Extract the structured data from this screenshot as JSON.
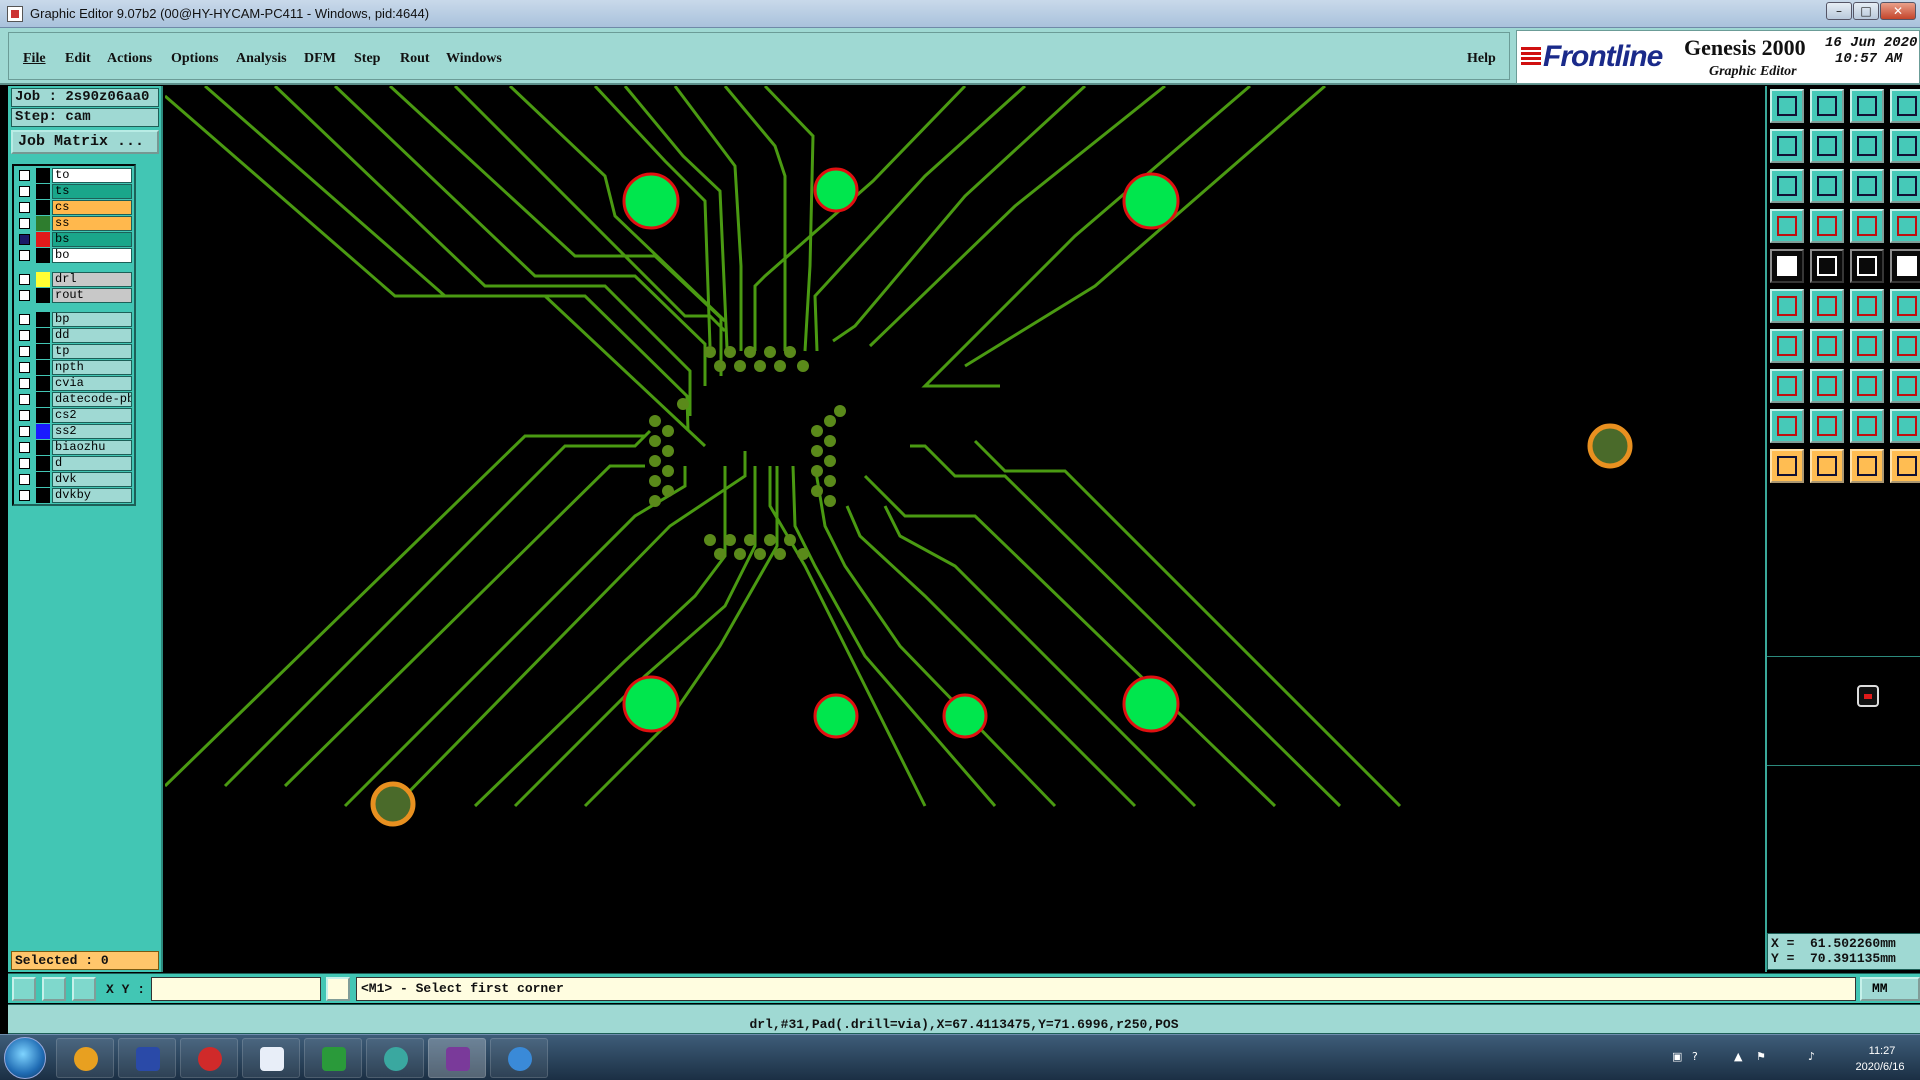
{
  "window": {
    "title": "Graphic Editor 9.07b2 (00@HY-HYCAM-PC411 - Windows, pid:4644)",
    "minimize": "–",
    "maximize": "□",
    "close": "✕"
  },
  "menu": {
    "items": [
      "File",
      "Edit",
      "Actions",
      "Options",
      "Analysis",
      "DFM",
      "Step",
      "Rout",
      "Windows"
    ],
    "help": "Help"
  },
  "brand": {
    "logo": "Frontline",
    "product": "Genesis 2000",
    "subtitle": "Graphic Editor",
    "date": "16 Jun 2020",
    "time": "10:57 AM"
  },
  "job": {
    "job_line": "Job : 2s90z06aa0",
    "step_line": "Step: cam",
    "matrix_button": "Job Matrix ..."
  },
  "layers": [
    {
      "name": "to",
      "swatch": "#000000",
      "bg": "#ffffff",
      "mark": "⸙",
      "checked": false
    },
    {
      "name": "ts",
      "swatch": "#000000",
      "bg": "#1aa68a",
      "mark": "",
      "checked": false
    },
    {
      "name": "cs",
      "swatch": "#000000",
      "bg": "#ffb84d",
      "mark": "⸙",
      "checked": false
    },
    {
      "name": "ss",
      "swatch": "#2e7d2e",
      "bg": "#ffb84d",
      "mark": "",
      "checked": false
    },
    {
      "name": "bs",
      "swatch": "#e01a1a",
      "bg": "#1aa68a",
      "mark": "▪",
      "checked": true
    },
    {
      "name": "bo",
      "swatch": "#000000",
      "bg": "#ffffff",
      "mark": "",
      "checked": false
    },
    {
      "name": "drl",
      "swatch": "#ffff33",
      "bg": "#c8c8c8",
      "mark": "",
      "checked": false
    },
    {
      "name": "rout",
      "swatch": "#000000",
      "bg": "#c8c8c8",
      "mark": "",
      "checked": false
    },
    {
      "name": "bp",
      "swatch": "#000000",
      "bg": "#9fd9d3",
      "mark": "",
      "checked": false
    },
    {
      "name": "dd",
      "swatch": "#000000",
      "bg": "#9fd9d3",
      "mark": "⸙",
      "checked": false
    },
    {
      "name": "tp",
      "swatch": "#000000",
      "bg": "#9fd9d3",
      "mark": "",
      "checked": false
    },
    {
      "name": "npth",
      "swatch": "#000000",
      "bg": "#9fd9d3",
      "mark": "",
      "checked": false
    },
    {
      "name": "cvia",
      "swatch": "#000000",
      "bg": "#9fd9d3",
      "mark": "",
      "checked": false
    },
    {
      "name": "datecode-pb",
      "swatch": "#000000",
      "bg": "#9fd9d3",
      "mark": "",
      "checked": false
    },
    {
      "name": "cs2",
      "swatch": "#000000",
      "bg": "#9fd9d3",
      "mark": "",
      "checked": false
    },
    {
      "name": "ss2",
      "swatch": "#1a1aff",
      "bg": "#9fd9d3",
      "mark": "",
      "checked": false
    },
    {
      "name": "biaozhu",
      "swatch": "#000000",
      "bg": "#9fd9d3",
      "mark": "",
      "checked": false
    },
    {
      "name": "d",
      "swatch": "#000000",
      "bg": "#9fd9d3",
      "mark": "",
      "checked": false
    },
    {
      "name": "dvk",
      "swatch": "#000000",
      "bg": "#9fd9d3",
      "mark": "",
      "checked": false
    },
    {
      "name": "dvkby",
      "swatch": "#000000",
      "bg": "#9fd9d3",
      "mark": "",
      "checked": false
    }
  ],
  "selected": "Selected : 0",
  "coords": {
    "x": "X =  61.502260mm",
    "y": "Y =  70.391135mm"
  },
  "command": {
    "xy_label": "X Y :",
    "xy_value": "",
    "prompt": "<M1> - Select first corner",
    "units": "MM"
  },
  "status_line": "drl,#31,Pad(.drill=via),X=67.4113475,Y=71.6996,r250,POS",
  "taskbar": {
    "time": "11:27",
    "date": "2020/6/16"
  },
  "colors": {
    "trace": "#4a9a12",
    "pad": "#5a8a1a",
    "via_fill": "#00e64d",
    "via_ring": "#e01010",
    "panel_teal": "#42c6b4",
    "panel_light": "#9fd9d3"
  }
}
